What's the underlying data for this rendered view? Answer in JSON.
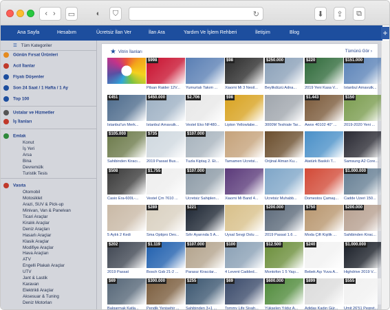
{
  "browser": {
    "buttons": {
      "back": "‹",
      "forward": "›",
      "sidebar": "▭",
      "shield": "◐",
      "privacy": "⛉",
      "reload": "↻",
      "download": "⬇",
      "share": "⇪",
      "tabs": "⧉",
      "newtab": "+"
    }
  },
  "nav": {
    "items": [
      "Ana Sayfa",
      "Hesabım",
      "Ücretsiz İlan Ver",
      "İlan Ara",
      "Yardım Ve İşlem Rehberi",
      "İletişim",
      "Blog"
    ]
  },
  "sidebar": {
    "all_categories": "Tüm Kategoriler",
    "quick": [
      "Günün Fırsat Ürünleri",
      "Acil İlanlar",
      "Fiyatı Düşenler",
      "Son 24 Saat / 1 Hafta / 1 Ay",
      "Top 100"
    ],
    "masters": "Ustalar ve Hizmetler",
    "jobs": "İş İlanları",
    "emlak_head": "Emlak",
    "emlak": [
      "Konut",
      "İş Yeri",
      "Arsa",
      "Bina",
      "Devremülk",
      "Turistik Tesis"
    ],
    "vasita_head": "Vasıta",
    "vasita": [
      "Otomobil",
      "Motosiklet",
      "Arazi, SUV & Pick-up",
      "Minivan, Van & Panelvan",
      "Ticari Araçlar",
      "Kiralık Araçlar",
      "Deniz Araçları",
      "Hasarlı Araçlar",
      "Klasik Araçlar",
      "Modifiye Araçlar",
      "Hava Araçları",
      "ATV",
      "Engelli Plakalı Araçlar",
      "UTV",
      "Jant & Lastik",
      "Karavan",
      "Elektrikli Araçlar",
      "Aksesuar & Tuning",
      "Deniz Motorları"
    ],
    "colors": {
      "orange": "#e58a1f",
      "blue": "#1d4e9e",
      "red": "#c0392b",
      "green": "#2f8a3c",
      "gray": "#555"
    }
  },
  "showcase": {
    "title": "Vitrin İlanları",
    "all": "Tümünü Gör",
    "arrow": "›",
    "rows": [
      [
        {
          "p": "",
          "c": ""
        },
        {
          "p": "$998",
          "c": "Pilsan Raider 12V..."
        },
        {
          "p": "",
          "c": "Yumurtalı Takım ..."
        },
        {
          "p": "$98",
          "c": "Xiaomi Mi 3 Nesil..."
        },
        {
          "p": "$250.000",
          "c": "Beylikdüzü Adna..."
        },
        {
          "p": "$220",
          "c": "2019 Yeni Kasa V..."
        },
        {
          "p": "$151.000",
          "c": "İstanbul Arnavutk..."
        }
      ],
      [
        {
          "p": "€451",
          "c": "İstanbul'un Merk..."
        },
        {
          "p": "$450.000",
          "c": "İstanbul Arnavutk..."
        },
        {
          "p": "$2.706",
          "c": "Vestel Eko NF480..."
        },
        {
          "p": "$98",
          "c": "Lipton Yellowlabe..."
        },
        {
          "p": "",
          "c": "3000M Teshiale Tar..."
        },
        {
          "p": "$1.443",
          "c": "Awox 40102 40\" ..."
        },
        {
          "p": "$150",
          "c": "2019-2020 Yeni ..."
        }
      ],
      [
        {
          "p": "$105.000",
          "c": "Sahibinden Kiracı..."
        },
        {
          "p": "$735",
          "c": "2019 Passat Bus..."
        },
        {
          "p": "$107.000",
          "c": "Tuzla Kiptaş 2. Et..."
        },
        {
          "p": "",
          "c": "Tamamen Ücretsi..."
        },
        {
          "p": "",
          "c": "Orijinal Alman Ku..."
        },
        {
          "p": "",
          "c": "Atatürk Baskılı T..."
        },
        {
          "p": "",
          "c": "Samsung A2 Core..."
        }
      ],
      [
        {
          "p": "$508",
          "c": "Casio Era-600L-..."
        },
        {
          "p": "$1.755",
          "c": "Vestel Çm 7610 ..."
        },
        {
          "p": "$107.000",
          "c": "Ücretsiz Sahiplen..."
        },
        {
          "p": "",
          "c": "Xiaomi Mi Band 4..."
        },
        {
          "p": "",
          "c": "Ücretsiz Muhabb..."
        },
        {
          "p": "",
          "c": "Domestos Çamaş..."
        },
        {
          "p": "$1.000.000",
          "c": "Cadde Üzeri 150..."
        }
      ],
      [
        {
          "p": "",
          "c": "5 Aylık 2 Kedi"
        },
        {
          "p": "$289",
          "c": "Sma Optipro Dev..."
        },
        {
          "p": "$221",
          "c": "Sıfır Ayarında 5 A..."
        },
        {
          "p": "",
          "c": "Uysal Sevgi Dolu ..."
        },
        {
          "p": "$200.000",
          "c": "2019 Passat 1.6 ..."
        },
        {
          "p": "$750",
          "c": "Moda Çift Kişilik ..."
        },
        {
          "p": "$200.000",
          "c": "Sahibinden Kirac..."
        }
      ],
      [
        {
          "p": "$202",
          "c": "2019 Passat"
        },
        {
          "p": "$1.119",
          "c": "Bosch Gsb 21-2 ..."
        },
        {
          "p": "$107.000",
          "c": "Parasız Kiracılar..."
        },
        {
          "p": "$100",
          "c": "4 Levent Cadded..."
        },
        {
          "p": "$12.500",
          "c": "Montofon 1 5 Yaşı..."
        },
        {
          "p": "$240",
          "c": "Bebek Aşı Yuva A..."
        },
        {
          "p": "$1.000.000",
          "c": "Highdrive 2019 V..."
        }
      ],
      [
        {
          "p": "$69",
          "c": "Balgarmak Katla..."
        },
        {
          "p": "$300.000",
          "c": "Pendik Yenişehir ..."
        },
        {
          "p": "$255",
          "c": "Sahibinden 3+1 ..."
        },
        {
          "p": "$69",
          "c": "Tommy Life Siyah..."
        },
        {
          "p": "$600.000",
          "c": "Yükselen Yıldız A..."
        },
        {
          "p": "$899",
          "c": "Adidas Kadın Gür..."
        },
        {
          "p": "$555",
          "c": "Ümit 26'51 Pegret..."
        }
      ]
    ],
    "row_colors": [
      [
        "#e9533a",
        "#c8102e",
        "#5a7fb4",
        "#2b2b2b",
        "#8aa0b8",
        "#2f6a3a",
        "#5b83b8"
      ],
      [
        "#4d6b8c",
        "#9db0c3",
        "#e8e8e8",
        "#d8a21f",
        "#a0a6ad",
        "#7b5a3a",
        "#7a9c4e"
      ],
      [
        "#6c7a4a",
        "#cfd8df",
        "#a7b3bd",
        "#c5a27a",
        "#6b4e2d",
        "#4a90c8",
        "#2a2a33"
      ],
      [
        "#3a3a3a",
        "#eeeeee",
        "#8c9aa6",
        "#5b3a7a",
        "#7fa6c8",
        "#d24a37",
        "#667f94"
      ],
      [
        "#c9b9a6",
        "#d9d0c0",
        "#1d2633",
        "#d8c08a",
        "#5c6a7a",
        "#b8966e",
        "#b7a090"
      ],
      [
        "#3f4652",
        "#1f5fae",
        "#b3a38c",
        "#8aa0b5",
        "#6b8e3a",
        "#f2f2f2",
        "#1a1f28"
      ],
      [
        "#556677",
        "#7a5c3c",
        "#3b5670",
        "#3a4a6a",
        "#4f8a3a",
        "#dcdcdc",
        "#f1f1f1"
      ]
    ]
  }
}
